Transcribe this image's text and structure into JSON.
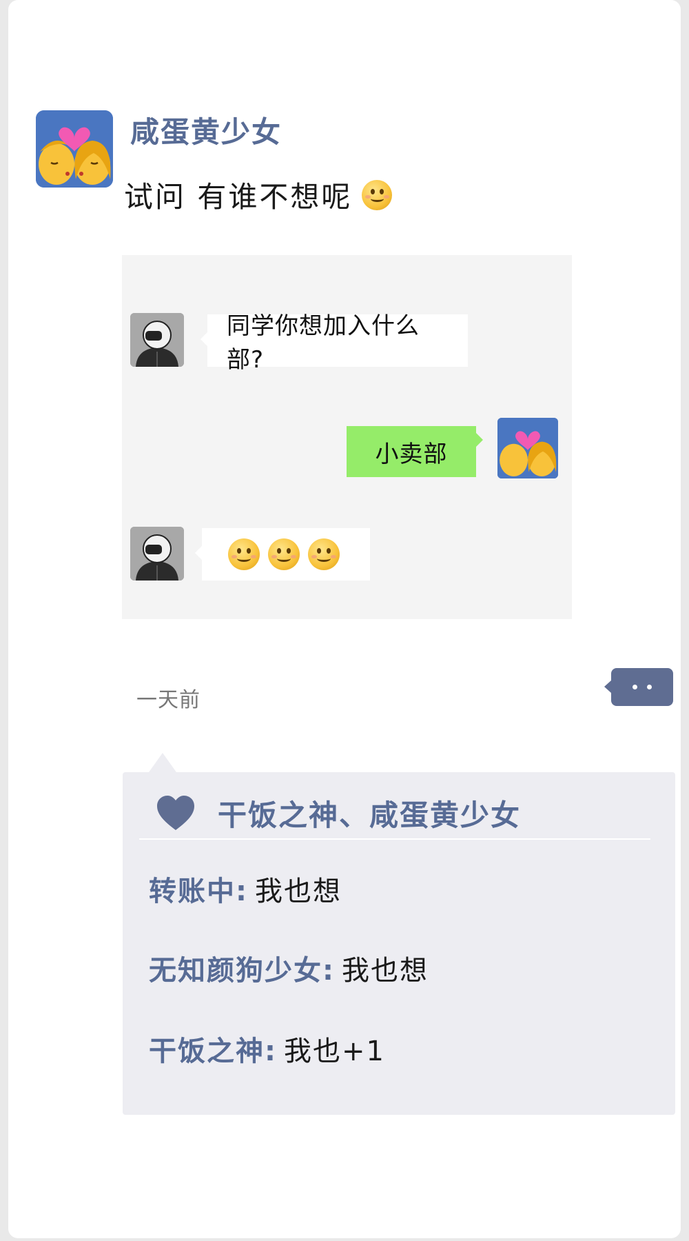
{
  "post": {
    "author": "咸蛋黄少女",
    "text": "试问 有谁不想呢",
    "avatar_icon": "kiss-couple-icon",
    "emoji_icon": "smile-emoji-icon"
  },
  "chat_screenshot": {
    "messages": [
      {
        "side": "left",
        "avatar_icon": "helmet-figure-icon",
        "text": "同学你想加入什么部?"
      },
      {
        "side": "right",
        "avatar_icon": "kiss-couple-icon",
        "text": "小卖部"
      },
      {
        "side": "left",
        "avatar_icon": "helmet-figure-icon",
        "emojis": [
          "smile-emoji-icon",
          "smile-emoji-icon",
          "smile-emoji-icon"
        ]
      }
    ]
  },
  "meta": {
    "time": "一天前",
    "more_icon": "more-dots-icon"
  },
  "likes": {
    "icon": "heart-icon",
    "names": "干饭之神、咸蛋黄少女"
  },
  "comments": [
    {
      "author": "转账中:",
      "text": "我也想"
    },
    {
      "author": "无知颜狗少女:",
      "text": "我也想"
    },
    {
      "author": "干饭之神:",
      "text": "我也+1"
    }
  ],
  "colors": {
    "name_blue": "#576b95",
    "bubble_green": "#95ec69",
    "panel_gray": "#ededf2"
  }
}
